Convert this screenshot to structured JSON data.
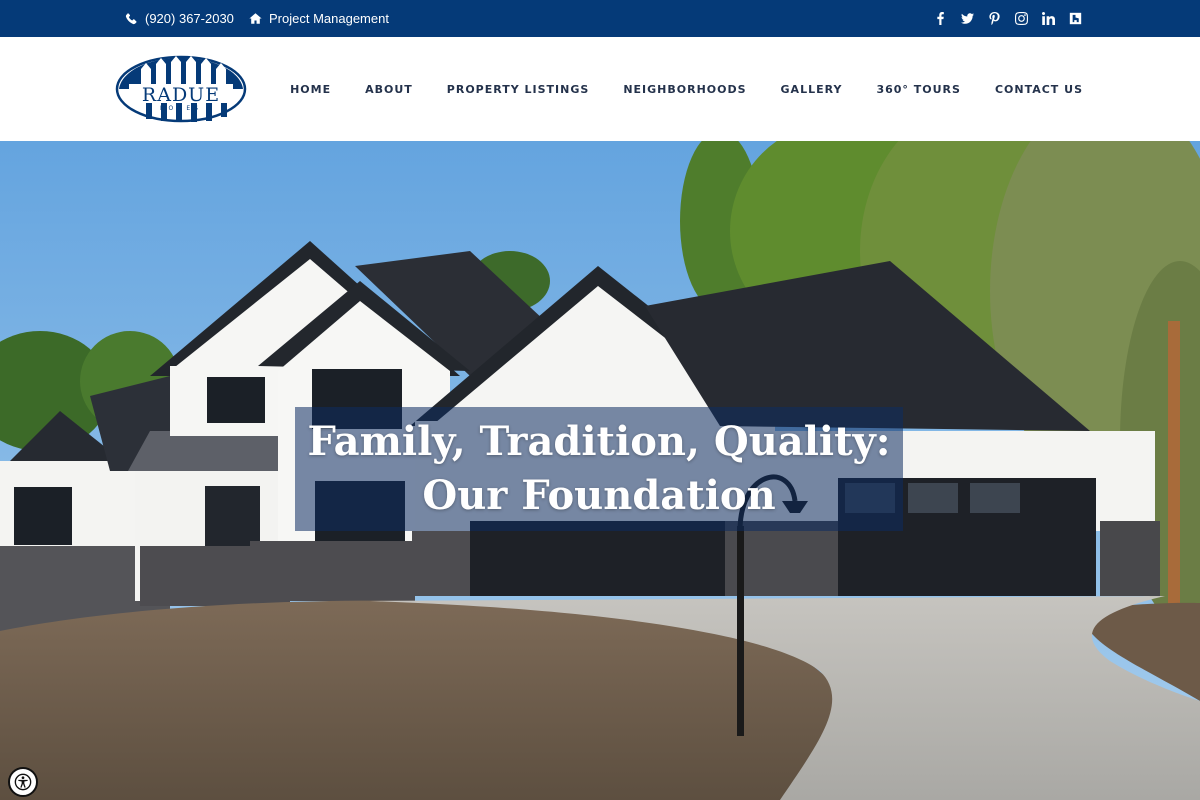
{
  "topbar": {
    "phone": "(920) 367-2030",
    "project_management": "Project Management",
    "social": [
      {
        "icon": "facebook-icon",
        "glyph": "f"
      },
      {
        "icon": "twitter-icon",
        "glyph": ""
      },
      {
        "icon": "pinterest-icon",
        "glyph": "p"
      },
      {
        "icon": "instagram-icon",
        "glyph": ""
      },
      {
        "icon": "linkedin-icon",
        "glyph": "in"
      },
      {
        "icon": "houzz-icon",
        "glyph": "h"
      }
    ]
  },
  "logo": {
    "name": "RADUE",
    "sub": "HOMES"
  },
  "nav": {
    "items": [
      "HOME",
      "ABOUT",
      "PROPERTY LISTINGS",
      "NEIGHBORHOODS",
      "GALLERY",
      "360° TOURS",
      "CONTACT US"
    ]
  },
  "hero": {
    "line1": "Family, Tradition, Quality:",
    "line2": "Our Foundation"
  },
  "colors": {
    "brand_blue": "#053a78",
    "nav_text": "#24324b"
  }
}
